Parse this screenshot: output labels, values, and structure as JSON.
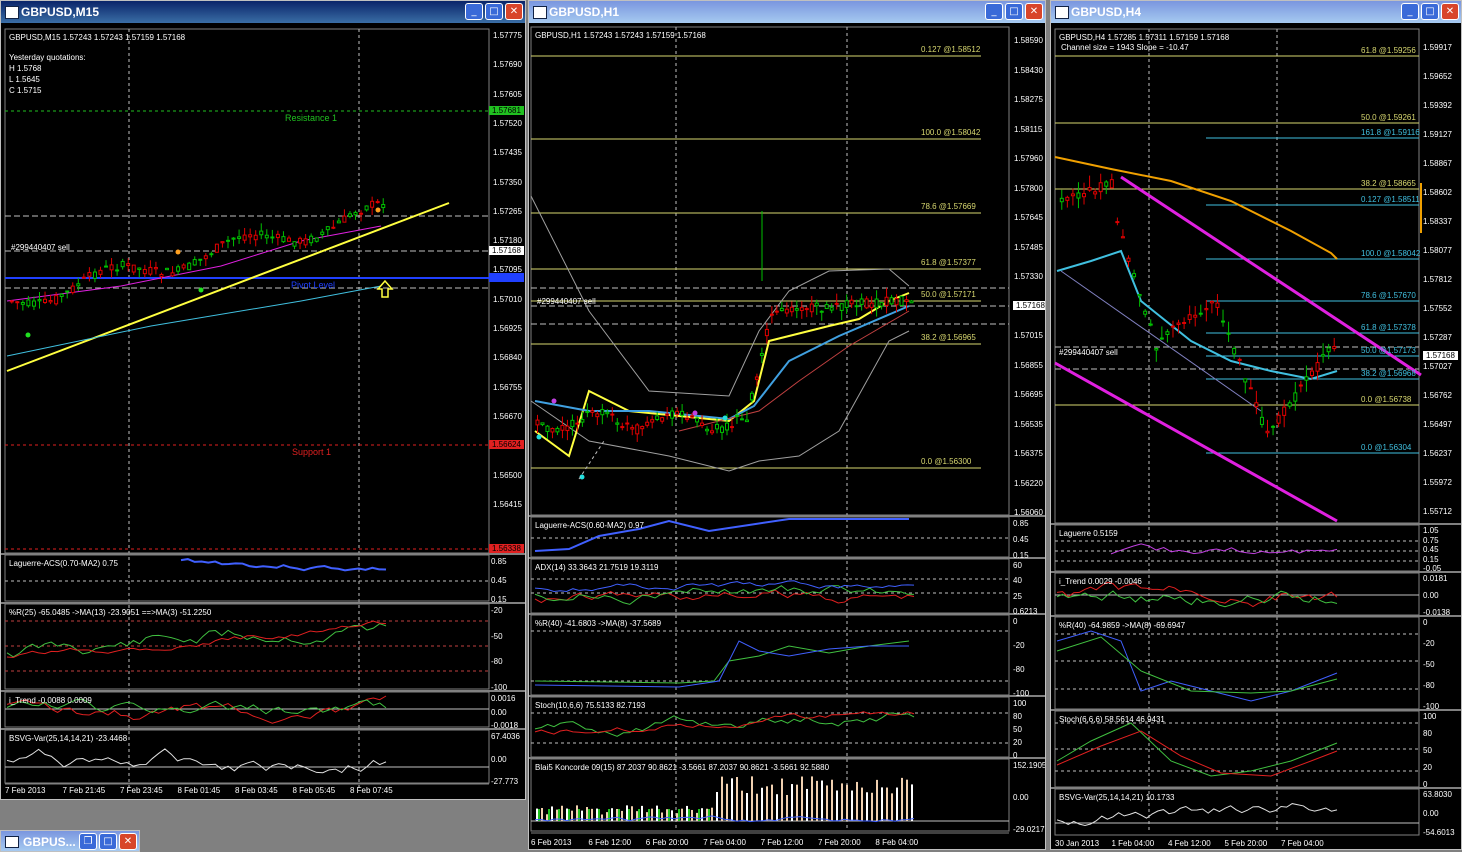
{
  "windows": {
    "m15": {
      "title": "GBPUSD,M15",
      "header": "GBPUSD,M15  1.57243 1.57243 1.57159 1.57168",
      "yesterday": {
        "label": "Yesterday quotations:",
        "h": "H 1.5768",
        "l": "L 1.5645",
        "c": "C 1.5715"
      },
      "resistance": "Resistance 1",
      "support": "Support 1",
      "pivot": "Pivot Level",
      "order": "#299440407 sell",
      "price_ticks": [
        "1.57775",
        "1.57690",
        "1.57605",
        "1.57520",
        "1.57435",
        "1.57350",
        "1.57265",
        "1.57180",
        "1.57095",
        "1.57010",
        "1.56925",
        "1.56840",
        "1.56755",
        "1.56670",
        "1.56585",
        "1.56500",
        "1.56415"
      ],
      "tags": {
        "resistance": "1.57681",
        "current": "1.57168",
        "pivot": "1.57052",
        "support": "1.56624",
        "low": "1.56338"
      },
      "indicators": [
        {
          "label": "Laguerre-ACS(0.70-MA2) 0.75",
          "ticks": [
            "0.85",
            "0.45",
            "0.15"
          ]
        },
        {
          "label": "%R(25) -65.0485  ->MA(13) -23.9051  ==>MA(3) -51.2250",
          "ticks": [
            "-20",
            "-50",
            "-80",
            "-100"
          ]
        },
        {
          "label": "i_Trend -0.0088 0.0009",
          "ticks": [
            "0.0016",
            "0.00",
            "-0.0018"
          ]
        },
        {
          "label": "BSVG-Var(25,14,14,21) -23.4468",
          "ticks": [
            "67.4036",
            "0.00",
            "-27.773"
          ]
        }
      ],
      "time_ticks": [
        "7 Feb 2013",
        "7 Feb 21:45",
        "7 Feb 23:45",
        "8 Feb 01:45",
        "8 Feb 03:45",
        "8 Feb 05:45",
        "8 Feb 07:45"
      ]
    },
    "h1": {
      "title": "GBPUSD,H1",
      "header": "GBPUSD,H1  1.57243 1.57243 1.57159 1.57168",
      "order": "#299440407 sell",
      "fibs": [
        "0.127 @1.58512",
        "100.0 @1.58042",
        "78.6 @1.57669",
        "61.8 @1.57377",
        "50.0 @1.57171",
        "38.2 @1.56965",
        "0.0 @1.56300"
      ],
      "price_ticks": [
        "1.58590",
        "1.58430",
        "1.58275",
        "1.58115",
        "1.57960",
        "1.57800",
        "1.57645",
        "1.57485",
        "1.57330",
        "1.57170",
        "1.57015",
        "1.56855",
        "1.56695",
        "1.56535",
        "1.56375",
        "1.56220",
        "1.56060"
      ],
      "current": "1.57168",
      "indicators": [
        {
          "label": "Laguerre-ACS(0.60-MA2) 0.97",
          "ticks": [
            "0.85",
            "0.45",
            "0.15"
          ]
        },
        {
          "label": "ADX(14) 33.3643 21.7519 19.3119",
          "ticks": [
            "60",
            "40",
            "25",
            "0.6213"
          ]
        },
        {
          "label": "%R(40) -41.6803  ->MA(8) -37.5689",
          "ticks": [
            "0",
            "-20",
            "-80",
            "-100"
          ]
        },
        {
          "label": "Stoch(10,6,6) 75.5133 82.7193",
          "ticks": [
            "100",
            "80",
            "50",
            "20",
            "0"
          ]
        },
        {
          "label": "Blai5 Koncorde 09(15) 87.2037 90.8621 -3.5661 87.2037 90.8621 -3.5661 92.5880",
          "ticks": [
            "152.1905",
            "0.00",
            "-29.0217"
          ]
        }
      ],
      "time_ticks": [
        "6 Feb 2013",
        "6 Feb 12:00",
        "6 Feb 20:00",
        "7 Feb 04:00",
        "7 Feb 12:00",
        "7 Feb 20:00",
        "8 Feb 04:00"
      ]
    },
    "h4": {
      "title": "GBPUSD,H4",
      "header": "GBPUSD,H4  1.57285 1.57311 1.57159 1.57168",
      "channel": "Channel size = 1943 Slope = -10.47",
      "order": "#299440407 sell",
      "fibs": [
        "61.8 @1.59256",
        "50.0 @1.59261",
        "161.8 @1.59116",
        "38.2 @1.58665",
        "0.127 @1.58511",
        "100.0 @1.58042",
        "78.6 @1.57670",
        "61.8 @1.57378",
        "50.0 @1.57173",
        "38.2 @1.56968",
        "0.0 @1.56738",
        "0.0 @1.56304"
      ],
      "price_ticks": [
        "1.59917",
        "1.59652",
        "1.59392",
        "1.59127",
        "1.58867",
        "1.58602",
        "1.58337",
        "1.58077",
        "1.57812",
        "1.57552",
        "1.57287",
        "1.57027",
        "1.56762",
        "1.56497",
        "1.56237",
        "1.55972",
        "1.55712"
      ],
      "current": "1.57168",
      "indicators": [
        {
          "label": "Laguerre 0.5159",
          "ticks": [
            "1.05",
            "0.75",
            "0.45",
            "0.15",
            "-0.05"
          ]
        },
        {
          "label": "i_Trend 0.0029 -0.0046",
          "ticks": [
            "0.0181",
            "0.00",
            "-0.0138"
          ]
        },
        {
          "label": "%R(40) -64.9859  ->MA(8) -69.6947",
          "ticks": [
            "0",
            "-20",
            "-50",
            "-80",
            "-100"
          ]
        },
        {
          "label": "Stoch(6,6,6) 58.5614 46.9431",
          "ticks": [
            "100",
            "80",
            "50",
            "20",
            "0"
          ]
        },
        {
          "label": "BSVG-Var(25,14,14,21) 10.1733",
          "ticks": [
            "63.8030",
            "0.00",
            "-54.6013"
          ]
        }
      ],
      "time_ticks": [
        "30 Jan 2013",
        "1 Feb 04:00",
        "4 Feb 12:00",
        "5 Feb 20:00",
        "7 Feb 04:00"
      ]
    }
  },
  "minimized": {
    "title": "GBPUS..."
  },
  "colors": {
    "title_active": "#0a246a",
    "bull": "#00c000",
    "bear": "#e00000",
    "fib": "#d8d870",
    "magenta": "#e020e0",
    "orange": "#f0a000",
    "cyan": "#40c0e0",
    "yellow": "#ffff40"
  }
}
